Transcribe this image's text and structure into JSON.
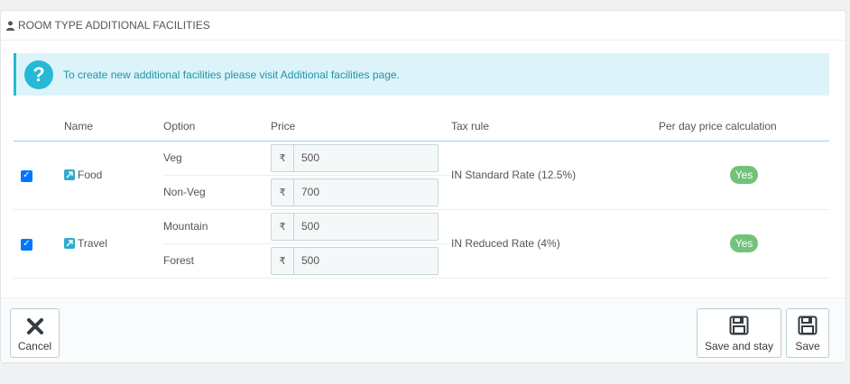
{
  "panel": {
    "title": "ROOM TYPE ADDITIONAL FACILITIES",
    "title_icon": "user-icon"
  },
  "alert": {
    "icon": "question-circle-icon",
    "text_before": "To create new additional facilities please visit ",
    "link_text": "Additional facilities",
    "text_after": " page."
  },
  "table": {
    "headers": {
      "name": "Name",
      "option": "Option",
      "price": "Price",
      "tax_rule": "Tax rule",
      "per_day": "Per day price calculation"
    },
    "rows": [
      {
        "checked": true,
        "name": "Food",
        "options": [
          {
            "label": "Veg",
            "currency": "₹",
            "price": "500"
          },
          {
            "label": "Non-Veg",
            "currency": "₹",
            "price": "700"
          }
        ],
        "tax_rule": "IN Standard Rate (12.5%)",
        "per_day": "Yes"
      },
      {
        "checked": true,
        "name": "Travel",
        "options": [
          {
            "label": "Mountain",
            "currency": "₹",
            "price": "500"
          },
          {
            "label": "Forest",
            "currency": "₹",
            "price": "500"
          }
        ],
        "tax_rule": "IN Reduced Rate (4%)",
        "per_day": "Yes"
      }
    ]
  },
  "footer": {
    "cancel_label": "Cancel",
    "save_and_stay_label": "Save and stay",
    "save_label": "Save"
  },
  "colors": {
    "accent": "#25b9d7",
    "badge_green": "#72c279",
    "checkbox_blue": "#0075ff"
  }
}
